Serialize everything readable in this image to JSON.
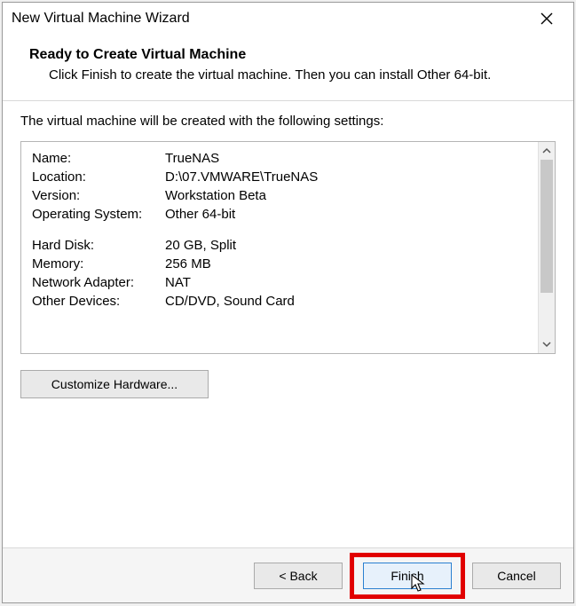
{
  "titlebar": {
    "title": "New Virtual Machine Wizard"
  },
  "header": {
    "heading": "Ready to Create Virtual Machine",
    "subtext": "Click Finish to create the virtual machine. Then you can install Other 64-bit."
  },
  "intro": "The virtual machine will be created with the following settings:",
  "settings": {
    "rows": [
      {
        "label": "Name:",
        "value": "TrueNAS"
      },
      {
        "label": "Location:",
        "value": "D:\\07.VMWARE\\TrueNAS"
      },
      {
        "label": "Version:",
        "value": "Workstation Beta"
      },
      {
        "label": "Operating System:",
        "value": "Other 64-bit"
      }
    ],
    "rows2": [
      {
        "label": "Hard Disk:",
        "value": "20 GB, Split"
      },
      {
        "label": "Memory:",
        "value": "256 MB"
      },
      {
        "label": "Network Adapter:",
        "value": "NAT"
      },
      {
        "label": "Other Devices:",
        "value": "CD/DVD, Sound Card"
      }
    ]
  },
  "buttons": {
    "customize": "Customize Hardware...",
    "back": "< Back",
    "finish": "Finish",
    "cancel": "Cancel"
  }
}
